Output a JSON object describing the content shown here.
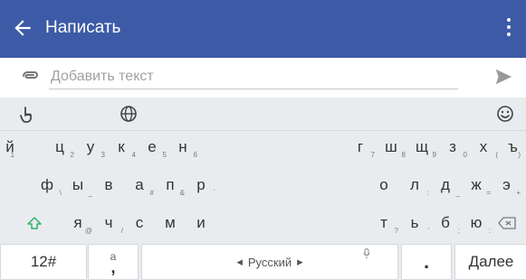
{
  "app_bar": {
    "back_icon": "arrow-left-icon",
    "title": "Написать",
    "menu_icon": "more-vert-icon",
    "color": "#3d5aa6"
  },
  "compose": {
    "attach_icon": "paperclip-icon",
    "placeholder": "Добавить текст",
    "send_icon": "send-icon"
  },
  "keyboard": {
    "tools": {
      "left_icon": "handwriting-icon",
      "globe_icon": "globe-icon",
      "emoji_icon": "emoji-icon"
    },
    "row1": [
      {
        "ch": "й",
        "sub": "1"
      },
      {
        "ch": "ц",
        "sub": "2"
      },
      {
        "ch": "у",
        "sub": "3"
      },
      {
        "ch": "к",
        "sub": "4"
      },
      {
        "ch": "е",
        "sub": "5"
      },
      {
        "ch": "н",
        "sub": "6"
      },
      {
        "ch": "г",
        "sub": "7"
      },
      {
        "ch": "ш",
        "sub": "8"
      },
      {
        "ch": "щ",
        "sub": "9"
      },
      {
        "ch": "з",
        "sub": "0"
      },
      {
        "ch": "х",
        "sub": "("
      },
      {
        "ch": "ъ",
        "sub": ")"
      }
    ],
    "row2": [
      {
        "ch": "ф",
        "sub": "\\"
      },
      {
        "ch": "ы",
        "sub": "_"
      },
      {
        "ch": "в",
        "sub": ""
      },
      {
        "ch": "а",
        "sub": "#"
      },
      {
        "ch": "п",
        "sub": "&"
      },
      {
        "ch": "р",
        "sub": "`"
      },
      {
        "ch": "о",
        "sub": ""
      },
      {
        "ch": "л",
        "sub": ":"
      },
      {
        "ch": "д",
        "sub": "_"
      },
      {
        "ch": "ж",
        "sub": "="
      },
      {
        "ch": "э",
        "sub": "+"
      }
    ],
    "row3": [
      {
        "ch": "я",
        "sub": "@"
      },
      {
        "ch": "ч",
        "sub": "/"
      },
      {
        "ch": "с",
        "sub": ""
      },
      {
        "ch": "м",
        "sub": ""
      },
      {
        "ch": "и",
        "sub": ""
      },
      {
        "ch": "т",
        "sub": "?"
      },
      {
        "ch": "ь",
        "sub": "'"
      },
      {
        "ch": "б",
        "sub": ";"
      },
      {
        "ch": "ю",
        "sub": ":"
      }
    ],
    "shift_icon": "shift-icon",
    "backspace_icon": "backspace-icon",
    "bottom": {
      "symbols": "12#",
      "comma_top": "а",
      "comma": ",",
      "space_label": "Русский",
      "space_left": "◂",
      "space_right": "▸",
      "mic_icon": "mic-icon",
      "period": ".",
      "enter": "Далее"
    }
  }
}
